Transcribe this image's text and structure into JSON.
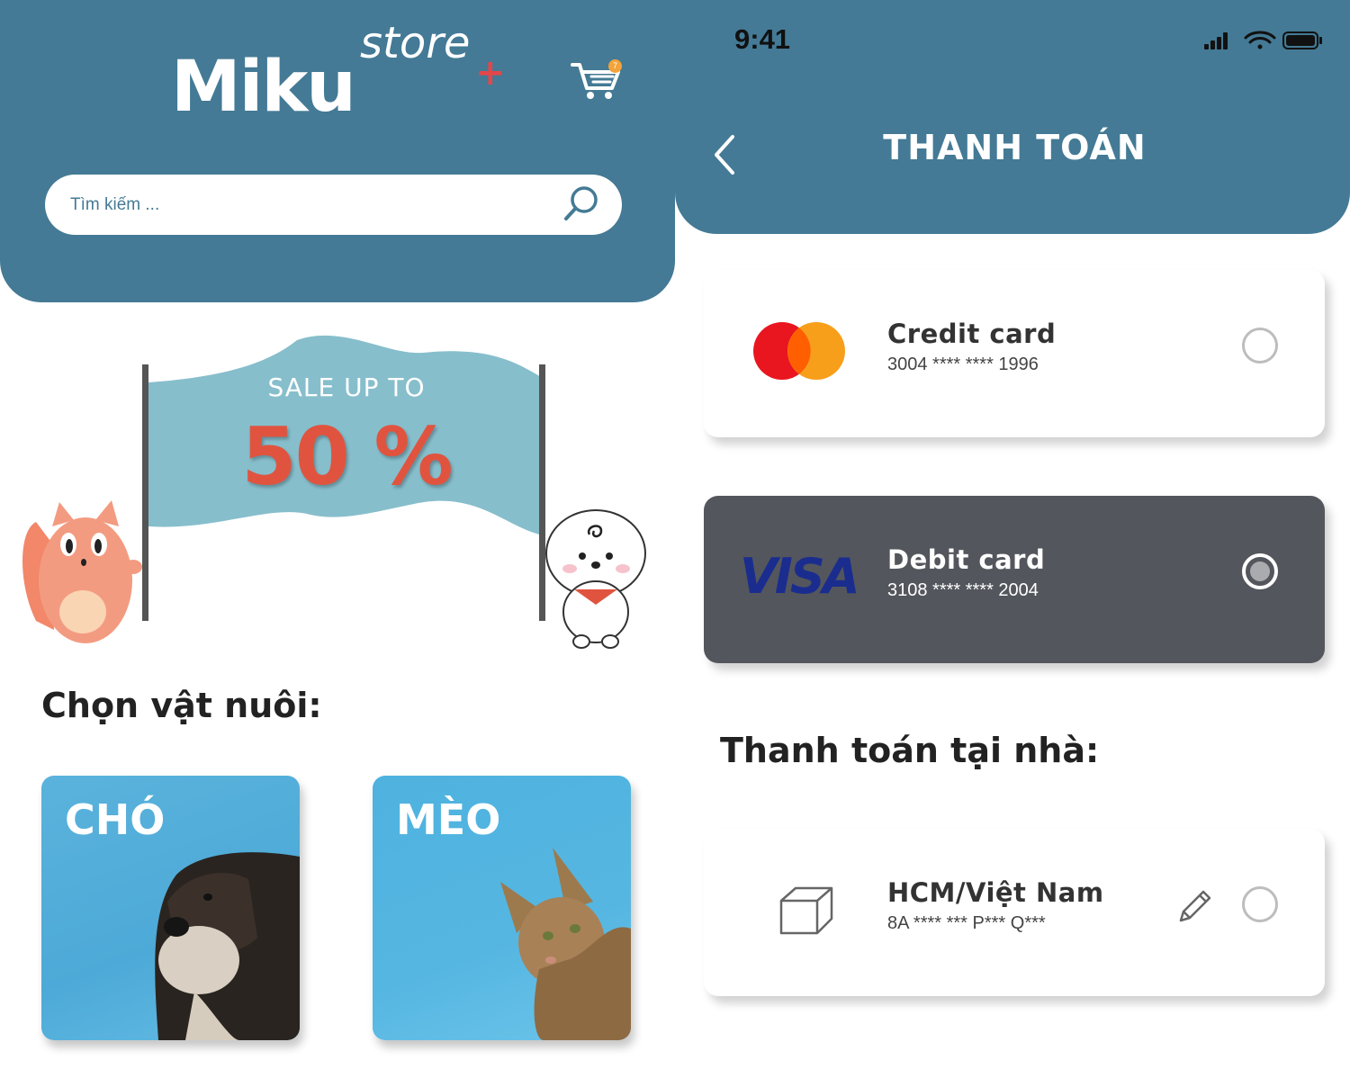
{
  "store": {
    "logo_main": "Miku",
    "logo_store": "store",
    "logo_plus": "+",
    "cart_badge": "7",
    "search_placeholder": "Tìm kiếm ...",
    "banner": {
      "line1": "SALE UP TO",
      "line2": "50 %"
    },
    "section_title": "Chọn vật nuôi:",
    "pets": [
      {
        "label": "CHÓ"
      },
      {
        "label": "MÈO"
      }
    ]
  },
  "payment": {
    "status_time": "9:41",
    "title": "THANH TOÁN",
    "cards": [
      {
        "name": "Credit card",
        "number": "3004 **** **** 1996",
        "selected": false
      },
      {
        "name": "Debit card",
        "number": "3108 **** **** 2004",
        "selected": true,
        "brand": "VISA"
      }
    ],
    "home_section_title": "Thanh toán tại nhà:",
    "home": {
      "name": "HCM/Việt Nam",
      "address": "8A **** *** P*** Q***",
      "selected": false
    }
  },
  "colors": {
    "header_blue": "#447A95",
    "flag_blue": "#87BECC",
    "sale_red": "#E0543F",
    "selected_card": "#53565C",
    "visa_blue": "#1A2D8F"
  }
}
